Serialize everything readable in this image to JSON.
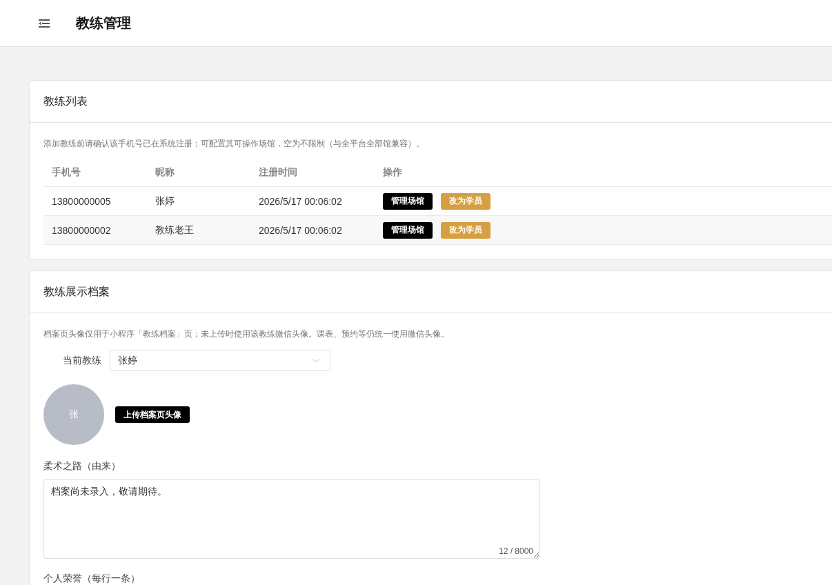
{
  "header": {
    "title": "教练管理"
  },
  "coach_list": {
    "title": "教练列表",
    "notice": "添加教练前请确认该手机号已在系统注册；可配置其可操作场馆，空为不限制（与全平台全部馆兼容）。",
    "table": {
      "columns": [
        "手机号",
        "昵称",
        "注册时间",
        "操作"
      ],
      "rows": [
        {
          "phone": "13800000005",
          "nickname": "张婷",
          "registered_at": "2026/5/17 00:06:02",
          "actions": [
            {
              "label": "管理场馆",
              "kind": "primary"
            },
            {
              "label": "改为学员",
              "kind": "warning"
            }
          ]
        },
        {
          "phone": "13800000002",
          "nickname": "教练老王",
          "registered_at": "2026/5/17 00:06:02",
          "actions": [
            {
              "label": "管理场馆",
              "kind": "primary"
            },
            {
              "label": "改为学员",
              "kind": "warning"
            }
          ]
        }
      ]
    }
  },
  "profile": {
    "title": "教练展示档案",
    "notice": "档案页头像仅用于小程序「教练档案」页；未上传时使用该教练微信头像。课表、预约等仍统一使用微信头像。",
    "coach_select": {
      "label": "当前教练",
      "value": "张婷"
    },
    "avatar": {
      "initial": "张"
    },
    "upload_button": "上传档案页头像",
    "fields": [
      {
        "label": "柔术之路（由来）",
        "value": "档案尚未录入，敬请期待。",
        "counter": "12 / 8000"
      },
      {
        "label": "个人荣誉（每行一条）"
      }
    ]
  }
}
